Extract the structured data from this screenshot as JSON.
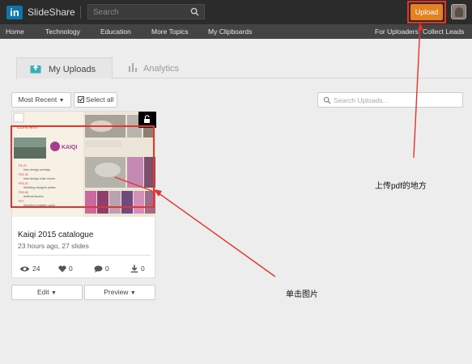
{
  "header": {
    "logo_text": "in",
    "brand": "SlideShare",
    "search_placeholder": "Search",
    "upload_label": "Upload"
  },
  "nav": {
    "left": [
      "Home",
      "Technology",
      "Education",
      "More Topics",
      "My Clipboards"
    ],
    "right": [
      "For Uploaders",
      "Collect Leads"
    ]
  },
  "tabs": [
    {
      "label": "My Uploads",
      "active": true
    },
    {
      "label": "Analytics",
      "active": false
    }
  ],
  "controls": {
    "sort_label": "Most Recent",
    "select_all_label": "Select all",
    "search_uploads_placeholder": "Search Uploads..."
  },
  "upload_card": {
    "title": "Kaiqi 2015 catalogue",
    "meta": "23 hours ago, 27 slides",
    "thumb": {
      "content_heading": "CONTENT",
      "brand": "KAIQI",
      "list": [
        {
          "num": "P4-22",
          "text": "New design overlays"
        },
        {
          "num": "P23-32",
          "text": "New design chair covers"
        },
        {
          "num": "P33-42",
          "text": "Wedding chargers plates"
        },
        {
          "num": "P43-46",
          "text": "Artificial flowers"
        },
        {
          "num": "P47",
          "text": "Wedding invitation cards"
        }
      ]
    },
    "stats": {
      "views": "24",
      "likes": "0",
      "comments": "0",
      "downloads": "0"
    },
    "edit_label": "Edit",
    "preview_label": "Preview"
  },
  "annotations": {
    "upload_note": "上传pdf的地方",
    "click_note": "单击图片"
  },
  "colors": {
    "topbar": "#2b2b2b",
    "navbar": "#444444",
    "upload_button": "#e5821f",
    "annotation_red": "#e8322b",
    "linkedin_blue": "#0e76a8"
  }
}
